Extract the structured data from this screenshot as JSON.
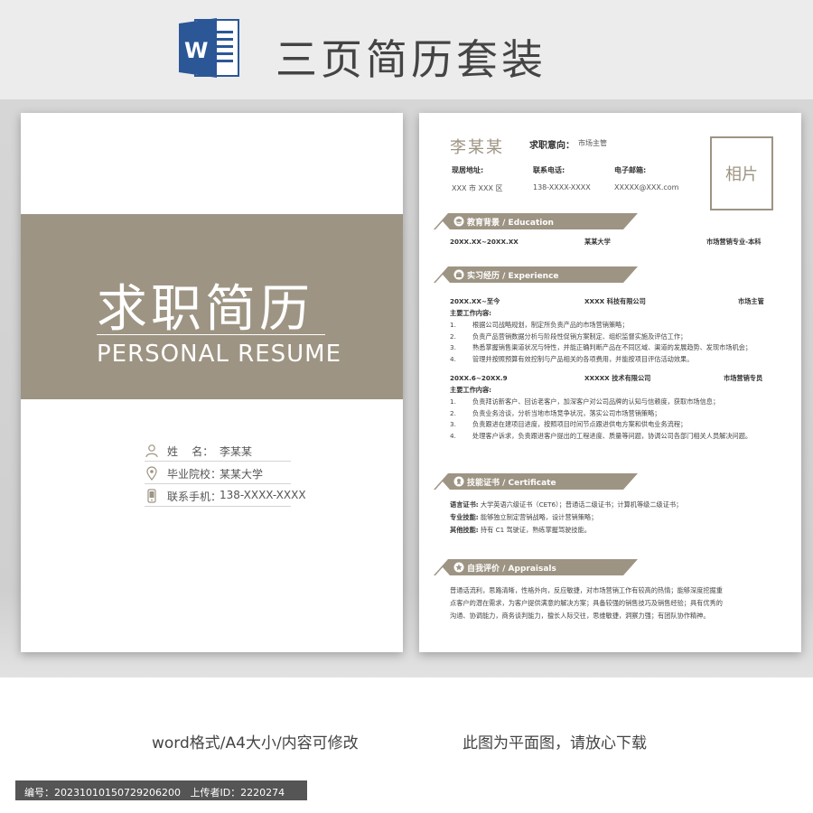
{
  "header": {
    "title": "三页简历套装",
    "icon": "word-icon"
  },
  "cover": {
    "title": "求职简历",
    "subtitle": "PERSONAL RESUME",
    "info": [
      {
        "icon": "person-icon",
        "label": "姓    名：",
        "value": "李某某"
      },
      {
        "icon": "location-icon",
        "label": "毕业院校：",
        "value": "某某大学"
      },
      {
        "icon": "phone-icon",
        "label": "联系手机：",
        "value": "138-XXXX-XXXX"
      }
    ],
    "accent": "#9d9483"
  },
  "resume": {
    "name": "李某某",
    "intent_label": "求职意向：",
    "intent_value": "市场主管",
    "contacts": [
      {
        "label": "现居地址:",
        "value": "XXX 市 XXX 区"
      },
      {
        "label": "联系电话:",
        "value": "138-XXXX-XXXX"
      },
      {
        "label": "电子邮箱:",
        "value": "XXXXX@XXX.com"
      }
    ],
    "photo": "相片",
    "education": {
      "heading": "教育背景 / Education",
      "period": "20XX.XX~20XX.XX",
      "school": "某某大学",
      "major": "市场营销专业-本科"
    },
    "experience": {
      "heading": "实习经历 / Experience",
      "jobs": [
        {
          "period": "20XX.XX~至今",
          "company": "XXXX 科技有限公司",
          "role": "市场主管",
          "content_label": "主要工作内容:",
          "items": [
            {
              "n": "1.",
              "t": "根据公司战略规划，制定所负责产品的市场营销策略；"
            },
            {
              "n": "2.",
              "t": "负责产品营销数据分析与阶段性促销方案制定、组织监督实施及评估工作；"
            },
            {
              "n": "3.",
              "t": "熟悉掌握销售渠道状况与特性，并能正确判断产品在不同区域、渠道的发展趋势、发现市场机会；"
            },
            {
              "n": "4.",
              "t": "管理并按照预算有效控制与产品相关的各项费用，并能按项目评估活动效果。"
            }
          ]
        },
        {
          "period": "20XX.6~20XX.9",
          "company": "XXXXX 技术有限公司",
          "role": "市场营销专员",
          "content_label": "主要工作内容:",
          "items": [
            {
              "n": "1.",
              "t": "负责拜访新客户、回访老客户，加深客户对公司品牌的认知与信赖度，获取市场信息；"
            },
            {
              "n": "2.",
              "t": "负责业务洽谈，分析当地市场竞争状况，落实公司市场营销策略；"
            },
            {
              "n": "3.",
              "t": "负责跟进在建项目进度，按照项目时间节点跟进供电方案和供电业务流程；"
            },
            {
              "n": "4.",
              "t": "处理客户诉求，负责跟进客户提出的工程进度、质量等问题，协调公司各部门相关人员解决问题。"
            }
          ]
        }
      ]
    },
    "skills": {
      "heading": "技能证书 / Certificate",
      "lines": [
        {
          "label": "语言证书:",
          "value": "大学英语六级证书（CET6）；普通话二级证书；计算机等级二级证书；"
        },
        {
          "label": "专业技能:",
          "value": "能够独立制定营销战略，设计营销策略；"
        },
        {
          "label": "其他技能:",
          "value": "持有 C1 驾驶证，熟练掌握驾驶技能。"
        }
      ]
    },
    "appraisal": {
      "heading": "自我评价 / Appraisals",
      "lines": [
        "普通话流利，思路清晰，性格外向，反应敏捷，对市场营销工作有较高的热情；能够深度挖掘重",
        "点客户的潜在需求，为客户提供满意的解决方案；具备较强的销售技巧及销售经验；具有优秀的",
        "沟通、协调能力，商务谈判能力，擅长人际交往，思维敏捷，洞察力强；有团队协作精神。"
      ]
    }
  },
  "footer": {
    "left": "word格式/A4大小/内容可修改",
    "right": "此图为平面图，请放心下载",
    "id_line": "编号：20231010150729206200   上传者ID：2220274"
  }
}
